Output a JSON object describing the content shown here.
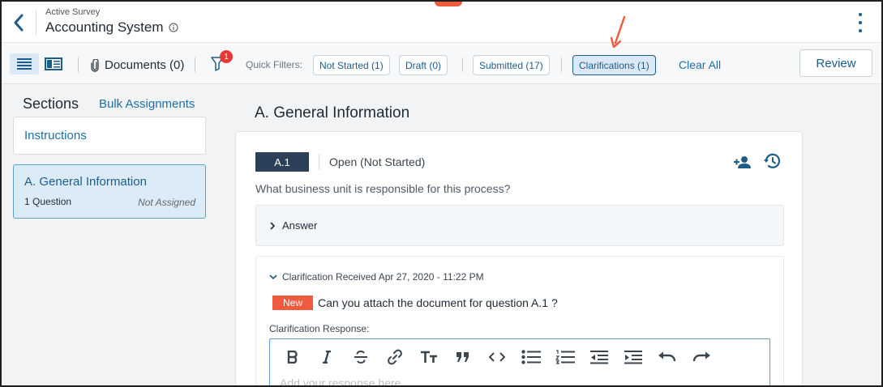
{
  "header": {
    "eyebrow": "Active Survey",
    "title": "Accounting System"
  },
  "toolbar": {
    "documents_label": "Documents (0)",
    "filter_badge": "1",
    "quick_filters_label": "Quick Filters:",
    "chips": {
      "not_started": "Not Started (1)",
      "draft": "Draft (0)",
      "submitted": "Submitted (17)",
      "clarifications": "Clarifications (1)"
    },
    "clear_all": "Clear All",
    "review": "Review"
  },
  "sidebar": {
    "title": "Sections",
    "bulk_link": "Bulk Assignments",
    "items": [
      {
        "label": "Instructions"
      },
      {
        "label": "A. General Information",
        "count": "1 Question",
        "assignee": "Not Assigned"
      }
    ]
  },
  "main": {
    "section_heading": "A. General Information",
    "question": {
      "number": "A.1",
      "status": "Open (Not Started)",
      "text": "What business unit is responsible for this process?",
      "answer_label": "Answer"
    },
    "clarification": {
      "header": "Clarification Received Apr 27, 2020 - 11:22 PM",
      "tag": "New",
      "message": "Can you attach the document for question A.1 ?",
      "response_label": "Clarification Response:",
      "response_placeholder": "Add your response here"
    }
  },
  "colors": {
    "accent": "#1d5d8a",
    "link": "#1d6fa6",
    "alert": "#ef5b3c",
    "badge": "#e53935",
    "selected_bg": "#dbe8f5"
  },
  "icons": [
    "back-icon",
    "info-icon",
    "kebab-icon",
    "list-view-icon",
    "card-view-icon",
    "paperclip-icon",
    "filter-icon",
    "assign-user-icon",
    "history-icon",
    "chevron-right-icon",
    "chevron-down-icon",
    "bold-icon",
    "italic-icon",
    "strikethrough-icon",
    "link-icon",
    "heading-icon",
    "quote-icon",
    "code-icon",
    "bullet-list-icon",
    "numbered-list-icon",
    "outdent-icon",
    "indent-icon",
    "undo-icon",
    "redo-icon"
  ]
}
